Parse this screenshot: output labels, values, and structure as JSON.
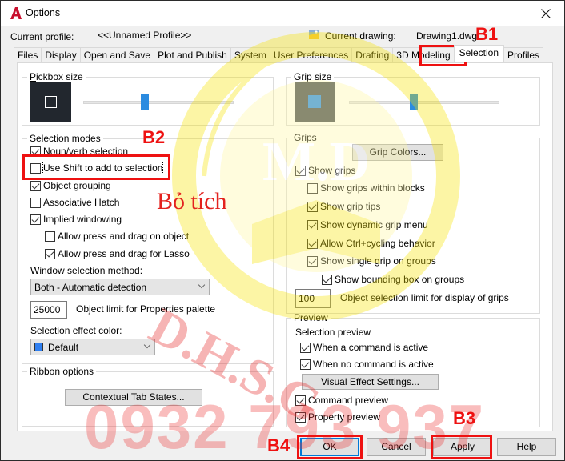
{
  "window": {
    "title": "Options",
    "close_icon": "close-icon"
  },
  "header": {
    "profile_label": "Current profile:",
    "profile_value": "<<Unnamed Profile>>",
    "drawing_label": "Current drawing:",
    "drawing_value": "Drawing1.dwg"
  },
  "tabs": [
    {
      "label": "Files",
      "active": false
    },
    {
      "label": "Display",
      "active": false
    },
    {
      "label": "Open and Save",
      "active": false
    },
    {
      "label": "Plot and Publish",
      "active": false
    },
    {
      "label": "System",
      "active": false
    },
    {
      "label": "User Preferences",
      "active": false
    },
    {
      "label": "Drafting",
      "active": false
    },
    {
      "label": "3D Modeling",
      "active": false
    },
    {
      "label": "Selection",
      "active": true
    },
    {
      "label": "Profiles",
      "active": false
    }
  ],
  "pickbox": {
    "title": "Pickbox size",
    "slider_value_fraction": 0.41,
    "preview_bg": "#22272e"
  },
  "selection_modes": {
    "title": "Selection modes",
    "options": [
      {
        "label": "Noun/verb selection",
        "checked": true
      },
      {
        "label": "Use Shift to add to selection",
        "checked": false
      },
      {
        "label": "Object grouping",
        "checked": true
      },
      {
        "label": "Associative Hatch",
        "checked": false
      },
      {
        "label": "Implied windowing",
        "checked": true
      },
      {
        "label": "Allow press and drag on object",
        "checked": false
      },
      {
        "label": "Allow press and drag for Lasso",
        "checked": true
      }
    ],
    "window_method_label": "Window selection method:",
    "window_method_value": "Both - Automatic detection",
    "object_limit_value": "25000",
    "object_limit_label": "Object limit for Properties palette",
    "effect_color_label": "Selection effect color:",
    "effect_color_value": "Default",
    "effect_color_swatch": "#2f7ff0"
  },
  "ribbon": {
    "title": "Ribbon options",
    "button_label": "Contextual Tab States..."
  },
  "grip_size": {
    "title": "Grip size",
    "slider_value_fraction": 0.43,
    "preview_bg": "#4a4f57",
    "grip_color": "#2b8fee"
  },
  "grips": {
    "title": "Grips",
    "colors_button": "Grip Colors...",
    "options": [
      {
        "label": "Show grips",
        "checked": true
      },
      {
        "label": "Show grips within blocks",
        "checked": false
      },
      {
        "label": "Show grip tips",
        "checked": true
      },
      {
        "label": "Show dynamic grip menu",
        "checked": true
      },
      {
        "label": "Allow Ctrl+cycling behavior",
        "checked": true
      },
      {
        "label": "Show single grip on groups",
        "checked": true
      },
      {
        "label": "Show bounding box on groups",
        "checked": true
      }
    ],
    "limit_value": "100",
    "limit_label": "Object selection limit for display of grips"
  },
  "preview": {
    "title": "Preview",
    "selection_preview_label": "Selection preview",
    "options": [
      {
        "label": "When a command is active",
        "checked": true
      },
      {
        "label": "When no command is active",
        "checked": true
      }
    ],
    "visual_effect_button": "Visual Effect Settings...",
    "command_preview": {
      "label": "Command preview",
      "checked": true
    },
    "property_preview": {
      "label": "Property preview",
      "checked": true
    }
  },
  "footer": {
    "ok": "OK",
    "cancel": "Cancel",
    "apply": "Apply",
    "help": "Help"
  },
  "annotations": {
    "b1": "B1",
    "b2": "B2",
    "b3": "B3",
    "b4": "B4",
    "note": "Bỏ tích",
    "color": "#ee1111"
  },
  "watermark": {
    "emblem_text": "M.D",
    "brand_text": "D.H.S.G",
    "phone": "0932 793 937"
  }
}
